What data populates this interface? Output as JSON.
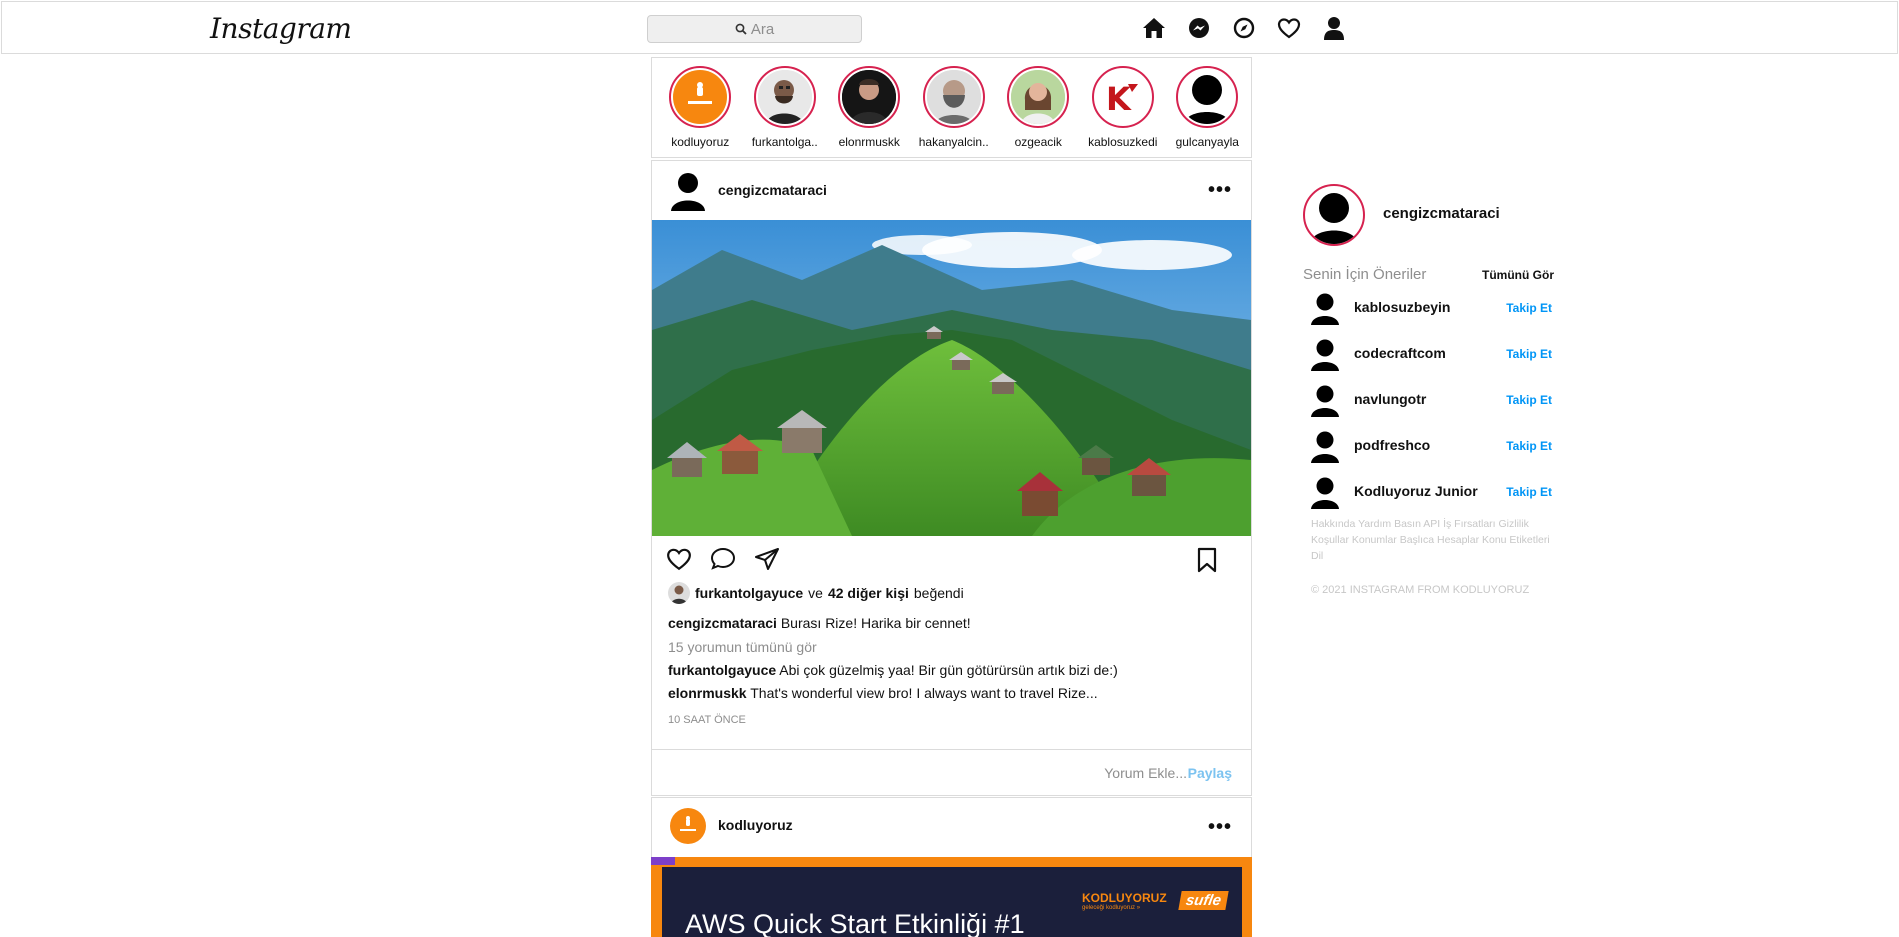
{
  "header": {
    "logo": "Instagram",
    "search_placeholder": "Ara",
    "nav_icons": [
      "home-icon",
      "messenger-icon",
      "explore-icon",
      "heart-icon",
      "profile-icon"
    ]
  },
  "stories": [
    {
      "name": "kodluyoruz",
      "kind": "brand"
    },
    {
      "name": "furkantolga..",
      "kind": "photo"
    },
    {
      "name": "elonrmuskk",
      "kind": "photo"
    },
    {
      "name": "hakanyalcin..",
      "kind": "photo"
    },
    {
      "name": "ozgeacik",
      "kind": "photo"
    },
    {
      "name": "kablosuzkedi",
      "kind": "logo"
    },
    {
      "name": "gulcanyayla",
      "kind": "default"
    }
  ],
  "post": {
    "username": "cengizcmataraci",
    "more": "•••",
    "liked_by_user": "furkantolgayuce",
    "liked_conj": "ve",
    "liked_others": "42 diğer kişi",
    "liked_suffix": "beğendi",
    "caption_user": "cengizcmataraci",
    "caption_text": "Burası Rize! Harika bir cennet!",
    "view_all_comments": "15 yorumun tümünü gör",
    "comments": [
      {
        "user": "furkantolgayuce",
        "text": "Abi çok güzelmiş yaa! Bir gün götürürsün artık bizi de:)"
      },
      {
        "user": "elonrmuskk",
        "text": "That's wonderful view bro! I always want to travel Rize..."
      }
    ],
    "time": "10 SAAT ÖNCE",
    "comment_placeholder": "Yorum Ekle...",
    "share_label": "Paylaş"
  },
  "post2": {
    "username": "kodluyoruz",
    "more": "•••",
    "banner_title": "AWS Quick Start Etkinliği #1",
    "banner_brand": "KODLUYORUZ",
    "banner_brand_sub": "geleceği kodluyoruz »",
    "banner_partner": "sufle"
  },
  "sidebar": {
    "me": "cengizcmataraci",
    "suggestions_title": "Senin İçin Öneriler",
    "see_all": "Tümünü Gör",
    "follow_label": "Takip Et",
    "suggestions": [
      "kablosuzbeyin",
      "codecraftcom",
      "navlungotr",
      "podfreshco",
      "Kodluyoruz Junior"
    ],
    "footer_links": "Hakkında Yardım Basın API İş Fırsatları Gizlilik Koşullar Konumlar Başlıca Hesaplar Konu Etiketleri Dil",
    "copyright": "© 2021 INSTAGRAM FROM KODLUYORUZ"
  },
  "colors": {
    "story_ring": "#d6224f",
    "link_blue": "#0095f6",
    "kodluyoruz_orange": "#f7870f"
  }
}
